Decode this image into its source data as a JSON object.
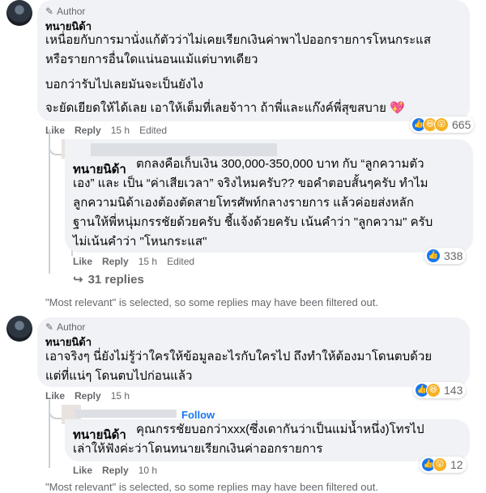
{
  "comment1": {
    "author_badge": "Author",
    "name": "ทนายนิด้า",
    "lines": [
      "เหนื่อยกับการมานั่งแก้ตัวว่าไม่เคยเรียกเงินค่าพาไปออกรายการโหนกระแส",
      "หรือรายการอื่นใดแน่นอนแม้แต่บาทเดียว",
      "บอกว่ารับไปเลยมันจะเป็นยังไง",
      "จะยัดเยียดให้ได้เลย เอาให้เต็มที่เลยจ้าาา ถ้าพี่และแก๊งค์พี่สุขสบาย 💖"
    ],
    "like": "Like",
    "reply": "Reply",
    "time": "15 h",
    "edited": "Edited",
    "reaction_count": "665"
  },
  "reply1": {
    "name": "ทนายนิด้า",
    "lines": [
      "ตกลงคือเก็บเงิน 300,000-350,000 บาท กับ “ลูกความตัว",
      "เอง” และ เป็น “ค่าเสียเวลา” จริงไหมครับ?? ขอคำตอบสั้นๆครับ ทำไม",
      "ลูกความนิด้าเองต้องตัดสายโทรศัพท์กลางรายการ แล้วค่อยส่งหลัก",
      "ฐานให้พี่หนุ่มกรรชัยด้วยครับ ชี้แจ้งด้วยครับ เน้นคำว่า \"ลูกความ\" ครับ",
      "ไม่เน้นคำว่า \"โหนกระแส\""
    ],
    "like": "Like",
    "reply": "Reply",
    "time": "15 h",
    "edited": "Edited",
    "reaction_count": "338"
  },
  "replies_link": "31 replies",
  "filter_note_1": "\"Most relevant\" is selected, so some replies may have been filtered out.",
  "comment2": {
    "author_badge": "Author",
    "name": "ทนายนิด้า",
    "lines": [
      "เอาจริงๆ นี่ยังไม่รู้ว่าใครให้ข้อมูลอะไรกับใครไป ถึงทำให้ต้องมาโดนตบด้วย",
      "แต่ที่แน่ๆ โดนตบไปก่อนแล้ว"
    ],
    "like": "Like",
    "reply": "Reply",
    "time": "15 h",
    "reaction_count": "143"
  },
  "reply2": {
    "follow": "Follow",
    "name": "ทนายนิด้า",
    "lines": [
      "คุณกรรชัยบอกว่าxxx(ซึ่งเดากันว่าเป็นแม่น้ำหนึ่ง)โทรไป",
      "เล่าให้ฟังค่ะว่าโดนทนายเรียกเงินค่าออกรายการ"
    ],
    "like": "Like",
    "reply": "Reply",
    "time": "10 h",
    "reaction_count": "12"
  },
  "filter_note_2": "\"Most relevant\" is selected, so some replies may have been filtered out."
}
